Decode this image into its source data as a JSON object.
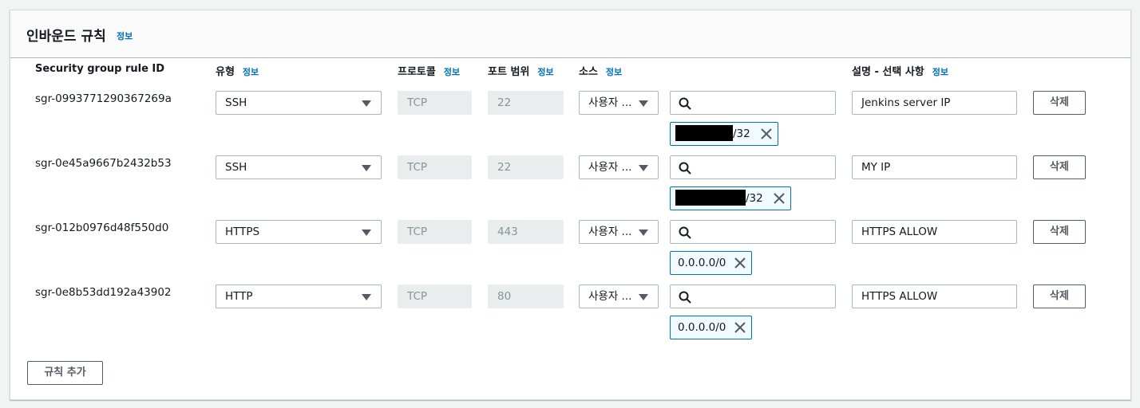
{
  "panel": {
    "title": "인바운드 규칙",
    "info": "정보",
    "add_rule": "규칙 추가"
  },
  "columns": {
    "rule_id": "Security group rule ID",
    "type": "유형",
    "protocol": "프로토콜",
    "port_range": "포트 범위",
    "source": "소스",
    "description": "설명 - 선택 사항",
    "info": "정보"
  },
  "rules": [
    {
      "id": "sgr-0993771290367269a",
      "type": "SSH",
      "protocol": "TCP",
      "port": "22",
      "source_type": "사용자 ...",
      "cidr_suffix": "/32",
      "description": "Jenkins server IP",
      "delete": "삭제"
    },
    {
      "id": "sgr-0e45a9667b2432b53",
      "type": "SSH",
      "protocol": "TCP",
      "port": "22",
      "source_type": "사용자 ...",
      "cidr_suffix": "/32",
      "description": "MY IP",
      "delete": "삭제"
    },
    {
      "id": "sgr-012b0976d48f550d0",
      "type": "HTTPS",
      "protocol": "TCP",
      "port": "443",
      "source_type": "사용자 ...",
      "cidr_suffix": "0.0.0.0/0",
      "description": "HTTPS ALLOW",
      "delete": "삭제"
    },
    {
      "id": "sgr-0e8b53dd192a43902",
      "type": "HTTP",
      "protocol": "TCP",
      "port": "80",
      "source_type": "사용자 ...",
      "cidr_suffix": "0.0.0.0/0",
      "description": "HTTPS ALLOW",
      "delete": "삭제"
    }
  ],
  "icons": {
    "search": "search-icon",
    "remove_token": "close-icon",
    "dropdown": "caret-down-icon"
  },
  "colors": {
    "link": "#0073bb",
    "token_border": "#0073bb",
    "token_bg": "#f1faff",
    "disabled_bg": "#eaeded"
  }
}
